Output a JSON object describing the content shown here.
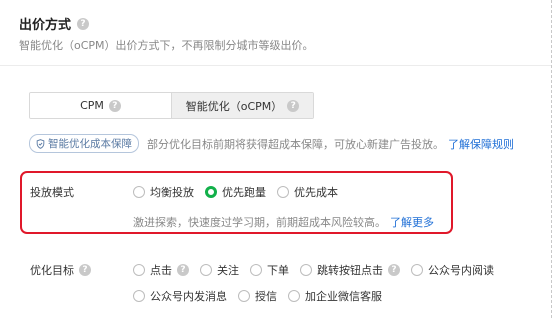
{
  "header": {
    "title": "出价方式",
    "subtitle": "智能优化（oCPM）出价方式下，不再限制分城市等级出价。"
  },
  "bid_mode_tabs": [
    {
      "label": "CPM",
      "selected": false
    },
    {
      "label": "智能优化（oCPM）",
      "selected": true
    }
  ],
  "guarantee": {
    "tag": "智能优化成本保障",
    "text": "部分优化目标前期将获得超成本保障，可放心新建广告投放。",
    "link": "了解保障规则"
  },
  "delivery_mode": {
    "label": "投放模式",
    "options": [
      {
        "label": "均衡投放",
        "checked": false
      },
      {
        "label": "优先跑量",
        "checked": true
      },
      {
        "label": "优先成本",
        "checked": false
      }
    ],
    "hint": "激进探索，快速度过学习期，前期超成本风险较高。",
    "hint_link": "了解更多"
  },
  "optimization_goal": {
    "label": "优化目标",
    "options_row1": [
      {
        "label": "点击",
        "help": true
      },
      {
        "label": "关注",
        "help": false
      },
      {
        "label": "下单",
        "help": false
      },
      {
        "label": "跳转按钮点击",
        "help": true
      },
      {
        "label": "公众号内阅读",
        "help": false
      }
    ],
    "options_row2": [
      {
        "label": "公众号内发消息",
        "help": false
      },
      {
        "label": "授信",
        "help": false
      },
      {
        "label": "加企业微信客服",
        "help": false
      }
    ]
  },
  "colors": {
    "accent_green": "#12b04a",
    "link_blue": "#1f6fd6",
    "highlight_red": "#e0182a"
  }
}
